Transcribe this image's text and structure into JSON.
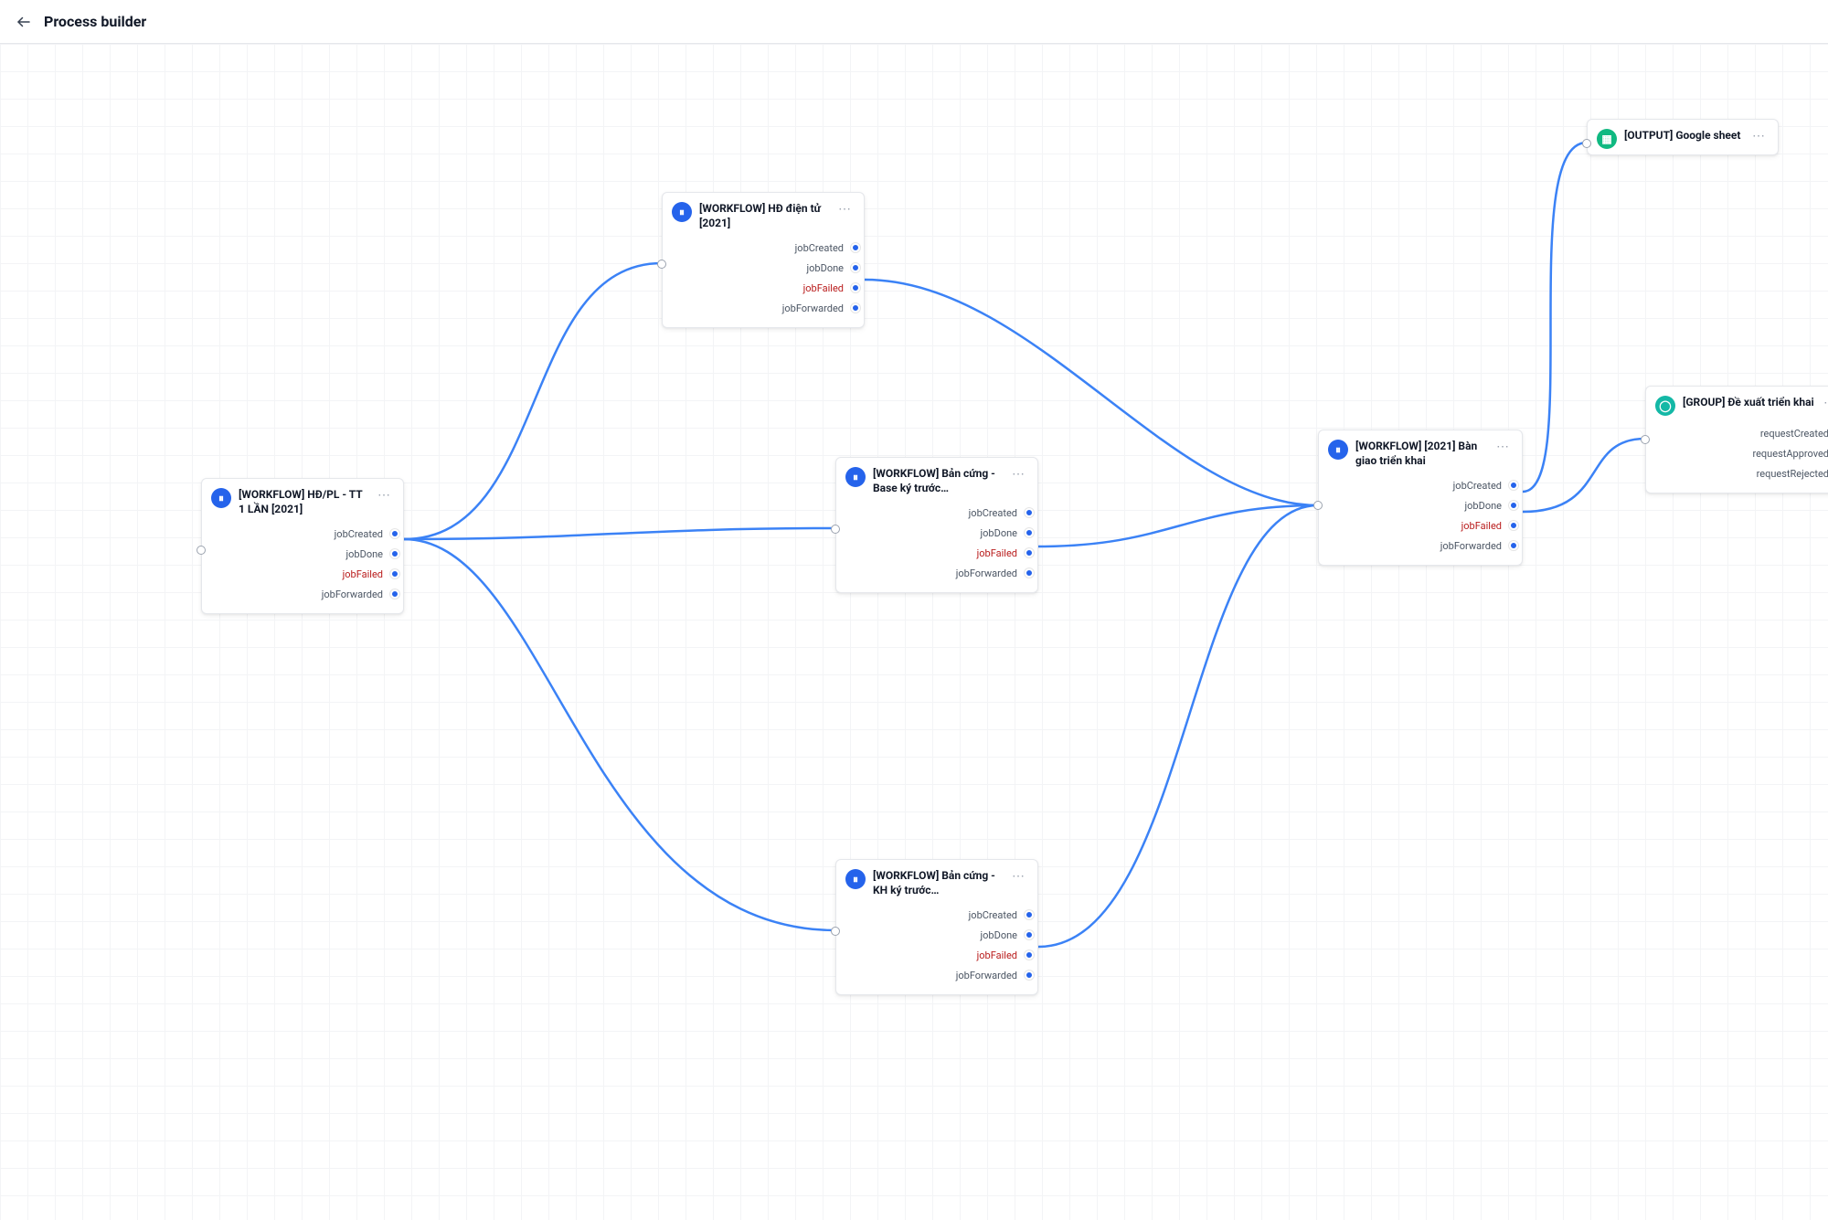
{
  "header": {
    "title": "Process builder"
  },
  "more_label": "⋯",
  "nodes": {
    "n1": {
      "icon": "blue",
      "iconGlyph": "⏸",
      "title": "[WORKFLOW] HĐ/PL - TT 1 LẦN [2021]",
      "outputs": [
        {
          "label": "jobCreated",
          "k": "jobCreated"
        },
        {
          "label": "jobDone",
          "k": "jobDone"
        },
        {
          "label": "jobFailed",
          "k": "jobFailed",
          "fail": true
        },
        {
          "label": "jobForwarded",
          "k": "jobForwarded"
        }
      ]
    },
    "n2": {
      "icon": "blue",
      "iconGlyph": "⏸",
      "title": "[WORKFLOW] HĐ điện tử [2021]",
      "outputs": [
        {
          "label": "jobCreated",
          "k": "jobCreated"
        },
        {
          "label": "jobDone",
          "k": "jobDone"
        },
        {
          "label": "jobFailed",
          "k": "jobFailed",
          "fail": true
        },
        {
          "label": "jobForwarded",
          "k": "jobForwarded"
        }
      ]
    },
    "n3": {
      "icon": "blue",
      "iconGlyph": "⏸",
      "title": "[WORKFLOW] Bản cứng - Base ký trước…",
      "outputs": [
        {
          "label": "jobCreated",
          "k": "jobCreated"
        },
        {
          "label": "jobDone",
          "k": "jobDone"
        },
        {
          "label": "jobFailed",
          "k": "jobFailed",
          "fail": true
        },
        {
          "label": "jobForwarded",
          "k": "jobForwarded"
        }
      ]
    },
    "n4": {
      "icon": "blue",
      "iconGlyph": "⏸",
      "title": "[WORKFLOW] Bản cứng - KH ký trước…",
      "outputs": [
        {
          "label": "jobCreated",
          "k": "jobCreated"
        },
        {
          "label": "jobDone",
          "k": "jobDone"
        },
        {
          "label": "jobFailed",
          "k": "jobFailed",
          "fail": true
        },
        {
          "label": "jobForwarded",
          "k": "jobForwarded"
        }
      ]
    },
    "n5": {
      "icon": "blue",
      "iconGlyph": "⏸",
      "title": "[WORKFLOW] [2021] Bàn giao triển khai",
      "outputs": [
        {
          "label": "jobCreated",
          "k": "jobCreated"
        },
        {
          "label": "jobDone",
          "k": "jobDone"
        },
        {
          "label": "jobFailed",
          "k": "jobFailed",
          "fail": true
        },
        {
          "label": "jobForwarded",
          "k": "jobForwarded"
        }
      ]
    },
    "n6": {
      "icon": "green",
      "iconGlyph": "▦",
      "title": "[OUTPUT] Google sheet",
      "outputs": []
    },
    "n7": {
      "icon": "teal",
      "iconGlyph": "◯",
      "title": "[GROUP] Đề xuất triển khai",
      "outputs": [
        {
          "label": "requestCreated",
          "k": "requestCreated"
        },
        {
          "label": "requestApproved",
          "k": "requestApproved"
        },
        {
          "label": "requestRejected",
          "k": "requestRejected"
        }
      ]
    }
  }
}
